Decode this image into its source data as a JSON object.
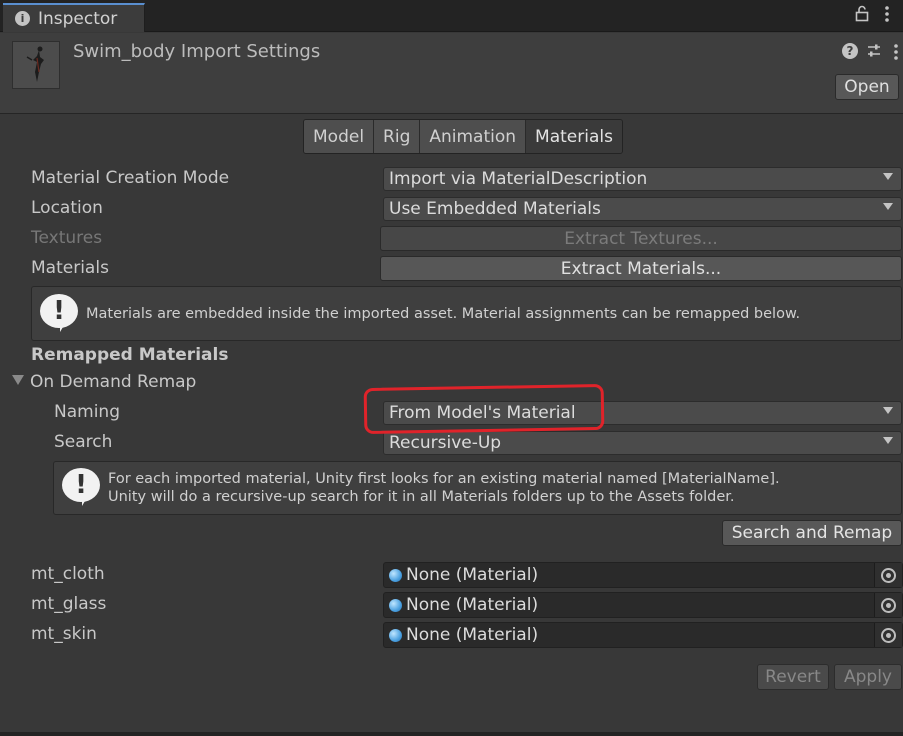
{
  "window": {
    "tab_title": "Inspector",
    "tab_icon": "info-icon",
    "lock_icon": "lock-icon",
    "menu_icon": "kebab-menu-icon"
  },
  "header": {
    "title": "Swim_body Import Settings",
    "open_label": "Open",
    "help_icon": "help-icon",
    "presets_icon": "sliders-icon",
    "menu_icon": "kebab-menu-icon"
  },
  "tabs": [
    {
      "label": "Model",
      "active": false
    },
    {
      "label": "Rig",
      "active": false
    },
    {
      "label": "Animation",
      "active": false
    },
    {
      "label": "Materials",
      "active": true
    }
  ],
  "materials": {
    "creation_mode_label": "Material Creation Mode",
    "creation_mode_value": "Import via MaterialDescription",
    "location_label": "Location",
    "location_value": "Use Embedded Materials",
    "textures_label": "Textures",
    "extract_textures_label": "Extract Textures...",
    "materials_label": "Materials",
    "extract_materials_label": "Extract Materials...",
    "embedded_info": "Materials are embedded inside the imported asset. Material assignments can be remapped below."
  },
  "remap": {
    "section_title": "Remapped Materials",
    "foldout_label": "On Demand Remap",
    "naming_label": "Naming",
    "naming_value": "From Model's Material",
    "search_label": "Search",
    "search_value": "Recursive-Up",
    "info_line1": "For each imported material, Unity first looks for an existing material named [MaterialName].",
    "info_line2": "Unity will do a recursive-up search for it in all Materials folders up to the Assets folder.",
    "search_and_remap_label": "Search and Remap"
  },
  "material_slots": [
    {
      "name": "mt_cloth",
      "value": "None (Material)"
    },
    {
      "name": "mt_glass",
      "value": "None (Material)"
    },
    {
      "name": "mt_skin",
      "value": "None (Material)"
    }
  ],
  "footer": {
    "revert_label": "Revert",
    "apply_label": "Apply"
  },
  "colors": {
    "annotation": "#e0232a",
    "active_tab_accent": "#5a8fd0",
    "background": "#383838"
  }
}
